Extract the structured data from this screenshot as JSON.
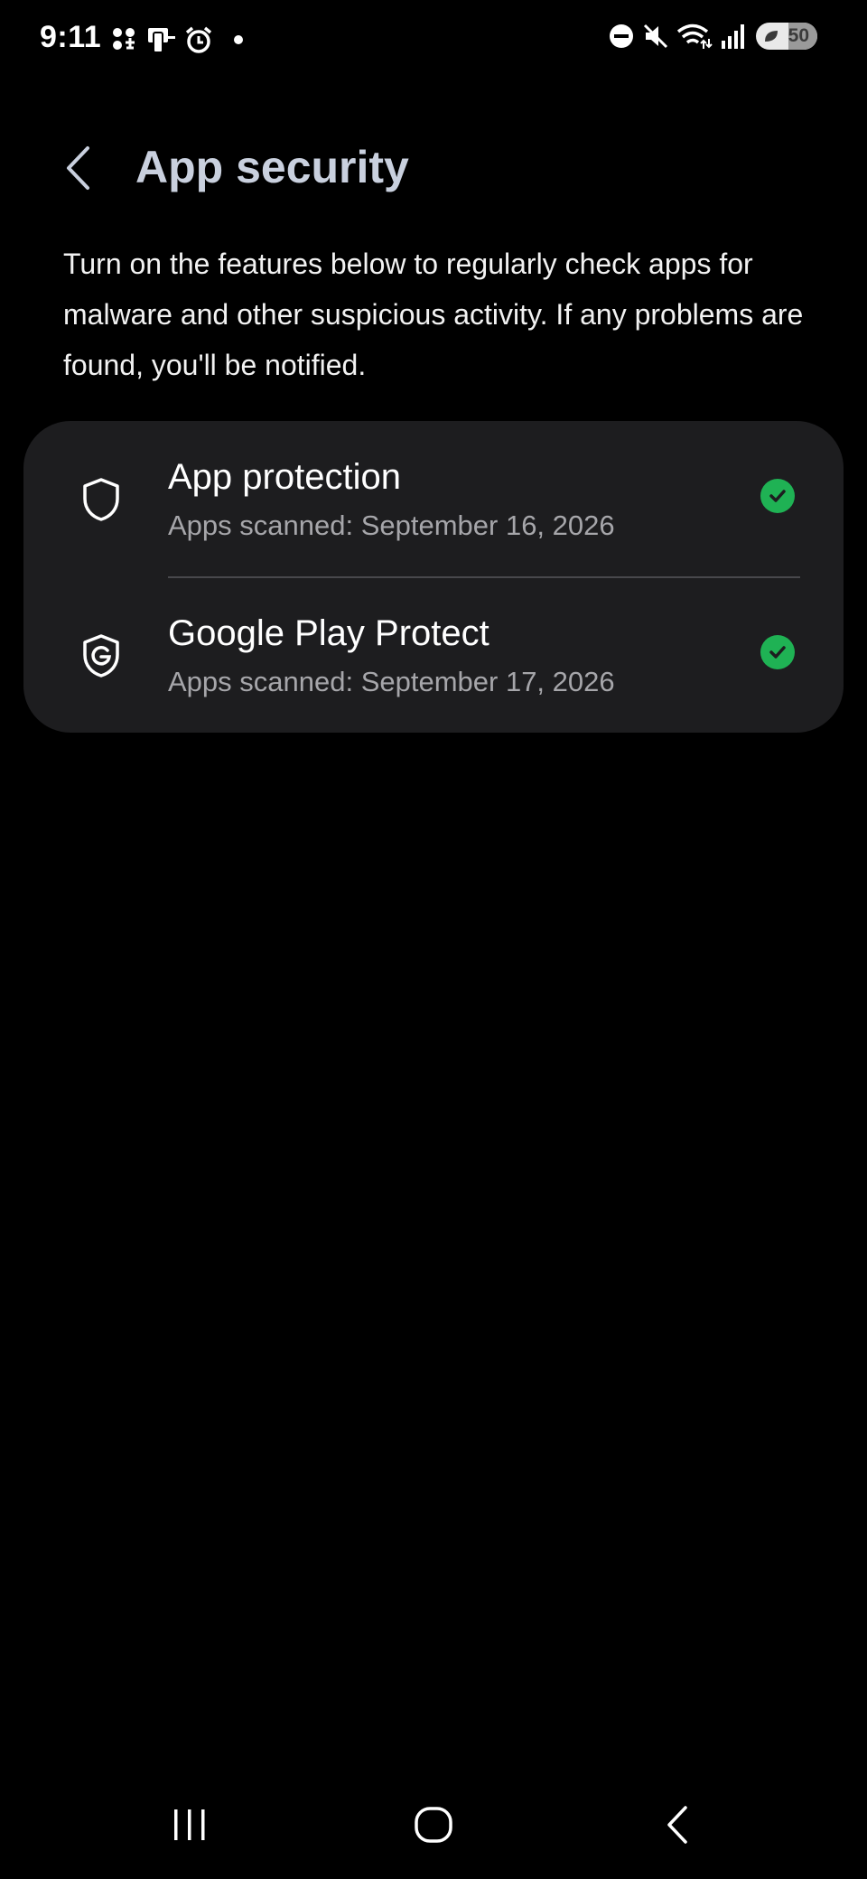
{
  "status_bar": {
    "time": "9:11",
    "battery_level": "50",
    "left_icons": [
      "grid-notification-icon",
      "device-notification-icon",
      "alarm-icon",
      "dot-icon"
    ],
    "right_icons": [
      "do-not-disturb-icon",
      "mute-icon",
      "wifi-icon",
      "signal-icon",
      "battery-icon"
    ]
  },
  "header": {
    "title": "App security",
    "back_icon": "chevron-left-icon"
  },
  "description": "Turn on the features below to regularly check apps for malware and other suspicious activity. If any problems are found, you'll be notified.",
  "features": [
    {
      "title": "App protection",
      "subtitle": "Apps scanned: September 16, 2026",
      "icon": "shield-icon",
      "status": "enabled",
      "status_icon": "check-circle-icon"
    },
    {
      "title": "Google Play Protect",
      "subtitle": "Apps scanned: September 17, 2026",
      "icon": "google-shield-icon",
      "status": "enabled",
      "status_icon": "check-circle-icon"
    }
  ],
  "nav_bar": {
    "buttons": [
      "recents-icon",
      "home-icon",
      "back-icon"
    ]
  },
  "colors": {
    "background": "#000000",
    "title": "#c9d0de",
    "card": "#1d1d1f",
    "subtitle": "#a6a6aa",
    "check": "#1fb254"
  }
}
